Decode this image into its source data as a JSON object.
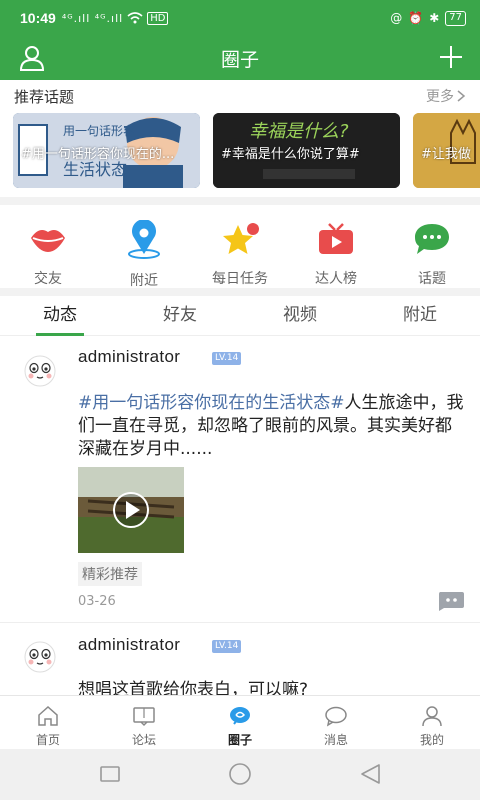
{
  "status_bar": {
    "time": "10:49",
    "signal": "⁴ᴳ.ıll ⁴ᴳ.ıll",
    "battery": "77"
  },
  "nav": {
    "title": "圈子",
    "icons": [
      "user-icon",
      "plus-icon"
    ]
  },
  "recommended": {
    "label": "推荐话题",
    "more": "更多",
    "cards": [
      {
        "caption": "#用一句话形容你现在的...",
        "color": "#3c5f8c"
      },
      {
        "caption": "#幸福是什么你说了算#",
        "color": "#1d1d1d"
      },
      {
        "caption": "#让我做",
        "color": "#c99a3a"
      }
    ]
  },
  "quick_actions": [
    {
      "label": "交友",
      "icon": "lips-icon",
      "color": "#e84c4c"
    },
    {
      "label": "附近",
      "icon": "location-pin-icon",
      "color": "#2a9be8"
    },
    {
      "label": "每日任务",
      "icon": "star-icon",
      "color": "#f5c518"
    },
    {
      "label": "达人榜",
      "icon": "tv-icon",
      "color": "#e84c4c"
    },
    {
      "label": "话题",
      "icon": "chat-bubble-icon",
      "color": "#3aa64a"
    }
  ],
  "tabs": [
    "动态",
    "好友",
    "视频",
    "附近"
  ],
  "active_tab": "动态",
  "posts": [
    {
      "username": "administrator",
      "level": "LV.14",
      "tag": "#用一句话形容你现在的生活状态#",
      "text": "人生旅途中，我们一直在寻觅，却忽略了眼前的风景。其实美好都深藏在岁月中......",
      "chip": "精彩推荐",
      "date": "03-26"
    },
    {
      "username": "administrator",
      "level": "LV.14",
      "text": "想唱这首歌给你表白，可以嘛?"
    }
  ],
  "bottom_tabs": [
    {
      "label": "首页",
      "icon": "home-icon"
    },
    {
      "label": "论坛",
      "icon": "forum-icon"
    },
    {
      "label": "圈子",
      "icon": "circle-icon"
    },
    {
      "label": "消息",
      "icon": "message-icon"
    },
    {
      "label": "我的",
      "icon": "profile-icon"
    }
  ],
  "active_bottom_tab": "圈子",
  "colors": {
    "brand": "#3aa64a",
    "tag_link": "#4a6fa5",
    "level_badge": "#8eb2e8"
  }
}
